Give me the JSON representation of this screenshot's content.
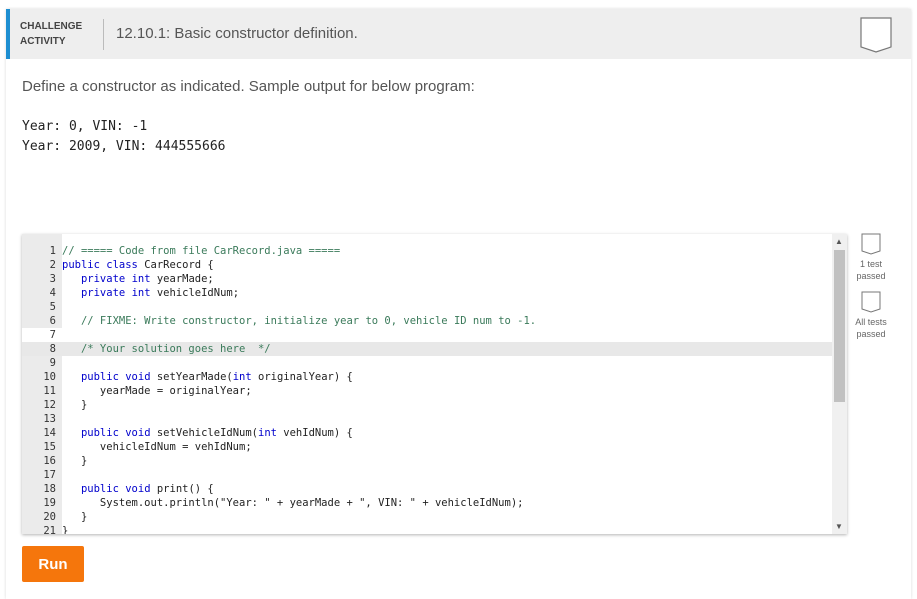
{
  "header": {
    "label_line1": "CHALLENGE",
    "label_line2": "ACTIVITY",
    "title": "12.10.1: Basic constructor definition."
  },
  "prompt": "Define a constructor as indicated. Sample output for below program:",
  "sample_output": [
    "Year: 0, VIN: -1",
    "Year: 2009, VIN: 444555666"
  ],
  "editor": {
    "active_line": 8,
    "lines": [
      "// ===== Code from file CarRecord.java =====",
      "public class CarRecord {",
      "   private int yearMade;",
      "   private int vehicleIdNum;",
      "",
      "   // FIXME: Write constructor, initialize year to 0, vehicle ID num to -1.",
      "",
      "   /* Your solution goes here  */",
      "",
      "   public void setYearMade(int originalYear) {",
      "      yearMade = originalYear;",
      "   }",
      "",
      "   public void setVehicleIdNum(int vehIdNum) {",
      "      vehicleIdNum = vehIdNum;",
      "   }",
      "",
      "   public void print() {",
      "      System.out.println(\"Year: \" + yearMade + \", VIN: \" + vehicleIdNum);",
      "   }",
      "}"
    ]
  },
  "tests": [
    {
      "label": "1 test passed",
      "passed": false
    },
    {
      "label": "All tests passed",
      "passed": false
    }
  ],
  "run_label": "Run",
  "colors": {
    "accent": "#1d8ed1",
    "run": "#f5760c"
  }
}
